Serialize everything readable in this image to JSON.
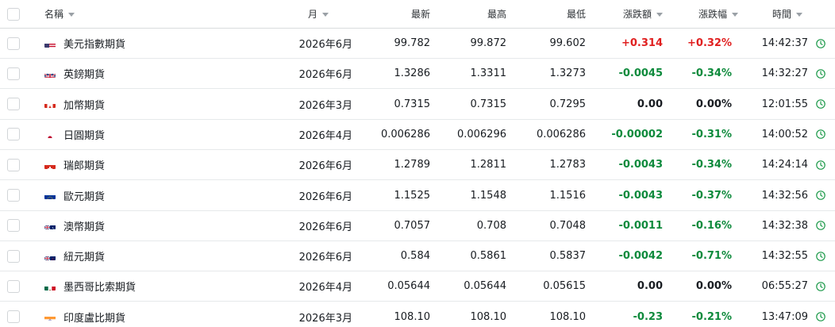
{
  "header": {
    "name": "名稱",
    "month": "月",
    "last": "最新",
    "high": "最高",
    "low": "最低",
    "change": "漲跌額",
    "change_pct": "漲跌幅",
    "time": "時間"
  },
  "colors": {
    "positive": "#e02020",
    "negative": "#0e8a3c",
    "clock": "#1d9a4a"
  },
  "rows": [
    {
      "flag": "us-flag-icon",
      "name": "美元指數期貨",
      "month": "2026年6月",
      "last": "99.782",
      "high": "99.872",
      "low": "99.602",
      "change": "+0.314",
      "change_pct": "+0.32%",
      "time": "14:42:37",
      "dir": "pos"
    },
    {
      "flag": "uk-flag-icon",
      "name": "英鎊期貨",
      "month": "2026年6月",
      "last": "1.3286",
      "high": "1.3311",
      "low": "1.3273",
      "change": "-0.0045",
      "change_pct": "-0.34%",
      "time": "14:32:27",
      "dir": "neg"
    },
    {
      "flag": "ca-flag-icon",
      "name": "加幣期貨",
      "month": "2026年3月",
      "last": "0.7315",
      "high": "0.7315",
      "low": "0.7295",
      "change": "0.00",
      "change_pct": "0.00%",
      "time": "12:01:55",
      "dir": "zero"
    },
    {
      "flag": "jp-flag-icon",
      "name": "日圓期貨",
      "month": "2026年4月",
      "last": "0.006286",
      "high": "0.006296",
      "low": "0.006286",
      "change": "-0.00002",
      "change_pct": "-0.31%",
      "time": "14:00:52",
      "dir": "neg"
    },
    {
      "flag": "ch-flag-icon",
      "name": "瑞郎期貨",
      "month": "2026年6月",
      "last": "1.2789",
      "high": "1.2811",
      "low": "1.2783",
      "change": "-0.0043",
      "change_pct": "-0.34%",
      "time": "14:24:14",
      "dir": "neg"
    },
    {
      "flag": "eu-flag-icon",
      "name": "歐元期貨",
      "month": "2026年6月",
      "last": "1.1525",
      "high": "1.1548",
      "low": "1.1516",
      "change": "-0.0043",
      "change_pct": "-0.37%",
      "time": "14:32:56",
      "dir": "neg"
    },
    {
      "flag": "au-flag-icon",
      "name": "澳幣期貨",
      "month": "2026年6月",
      "last": "0.7057",
      "high": "0.708",
      "low": "0.7048",
      "change": "-0.0011",
      "change_pct": "-0.16%",
      "time": "14:32:38",
      "dir": "neg"
    },
    {
      "flag": "nz-flag-icon",
      "name": "紐元期貨",
      "month": "2026年6月",
      "last": "0.584",
      "high": "0.5861",
      "low": "0.5837",
      "change": "-0.0042",
      "change_pct": "-0.71%",
      "time": "14:32:55",
      "dir": "neg"
    },
    {
      "flag": "mx-flag-icon",
      "name": "墨西哥比索期貨",
      "month": "2026年4月",
      "last": "0.05644",
      "high": "0.05644",
      "low": "0.05615",
      "change": "0.00",
      "change_pct": "0.00%",
      "time": "06:55:27",
      "dir": "zero"
    },
    {
      "flag": "in-flag-icon",
      "name": "印度盧比期貨",
      "month": "2026年3月",
      "last": "108.10",
      "high": "108.10",
      "low": "108.10",
      "change": "-0.23",
      "change_pct": "-0.21%",
      "time": "13:47:09",
      "dir": "neg"
    }
  ]
}
